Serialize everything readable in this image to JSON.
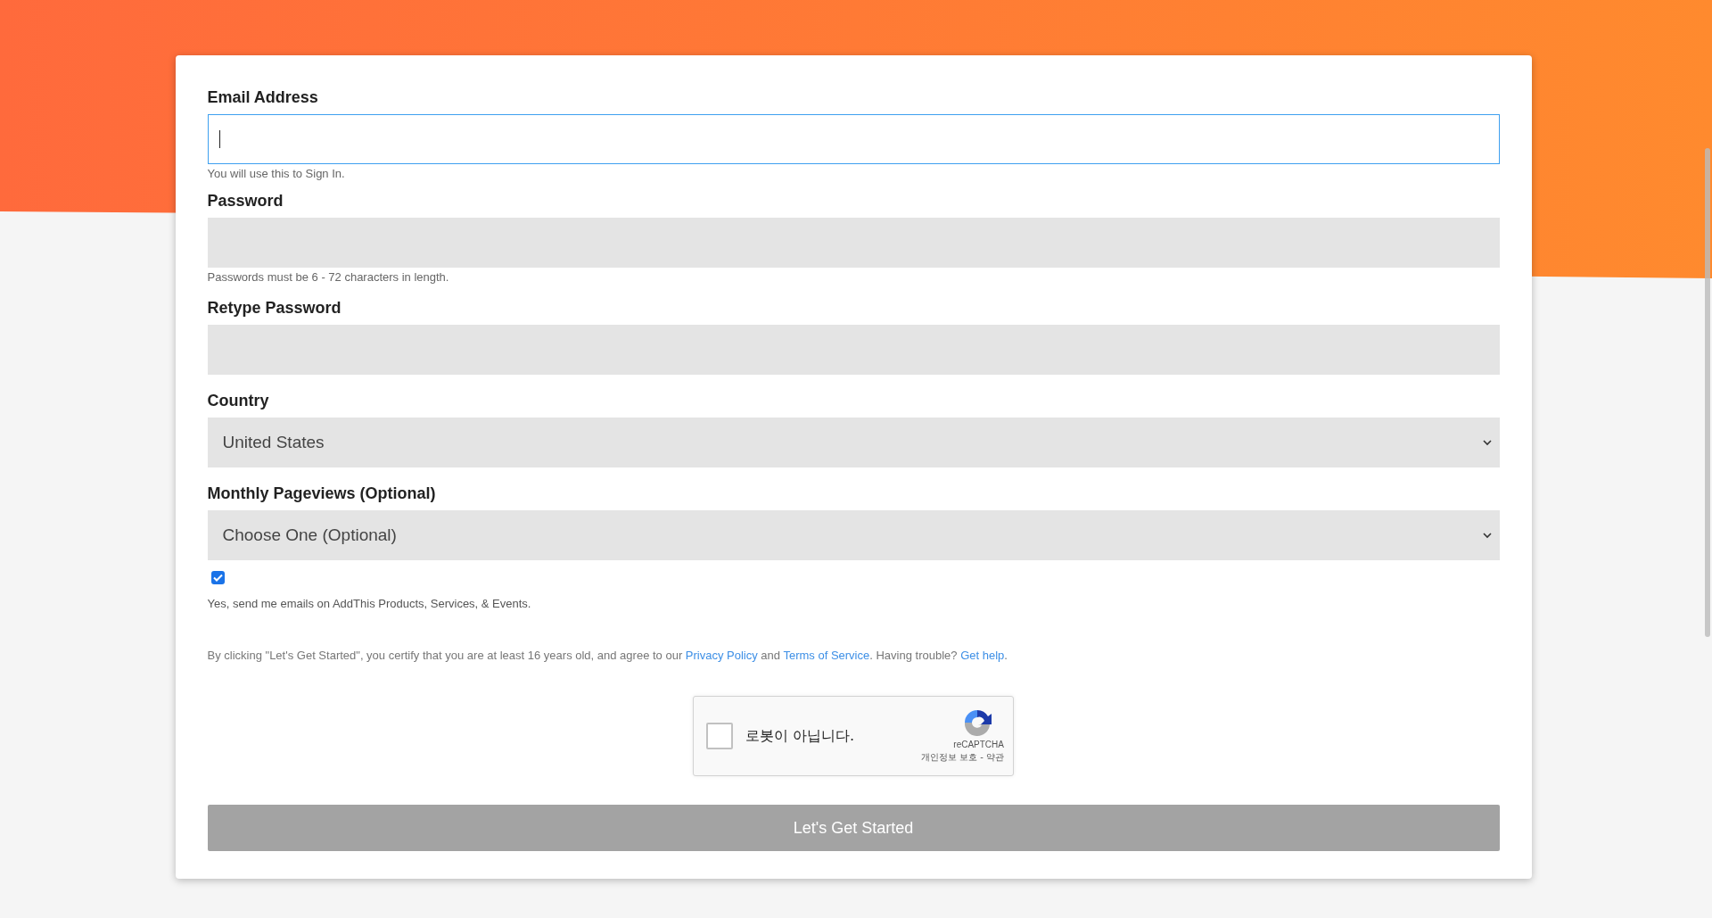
{
  "fields": [
    {
      "kind": "input",
      "label": "Email Address",
      "focused": true,
      "help": "You will use this to Sign In."
    },
    {
      "kind": "input",
      "label": "Password",
      "focused": false,
      "help": "Passwords must be 6 - 72 characters in length."
    },
    {
      "kind": "input",
      "label": "Retype Password",
      "focused": false
    },
    {
      "kind": "select",
      "label": "Country",
      "value": "United States",
      "focused": false
    },
    {
      "kind": "select",
      "label": "Monthly Pageviews (Optional)",
      "value": "Choose One (Optional)",
      "focused": false
    }
  ],
  "newsletter": {
    "checked": true,
    "label": "Yes, send me emails on AddThis Products, Services, & Events."
  },
  "terms": [
    {
      "kind": "text",
      "text": "By clicking \"Let's Get Started\", you certify that you are at least 16 years old, and agree to our "
    },
    {
      "kind": "link",
      "text": "Privacy Policy"
    },
    {
      "kind": "text",
      "text": " and "
    },
    {
      "kind": "link",
      "text": "Terms of Service"
    },
    {
      "kind": "text",
      "text": ". Having trouble? "
    },
    {
      "kind": "link",
      "text": "Get help"
    },
    {
      "kind": "text",
      "text": "."
    }
  ],
  "captcha": {
    "checked": false,
    "label": "로봇이 아닙니다.",
    "brand": "reCAPTCHA",
    "links": "개인정보 보호 - 약관"
  },
  "submit": {
    "label": "Let's Get Started"
  }
}
